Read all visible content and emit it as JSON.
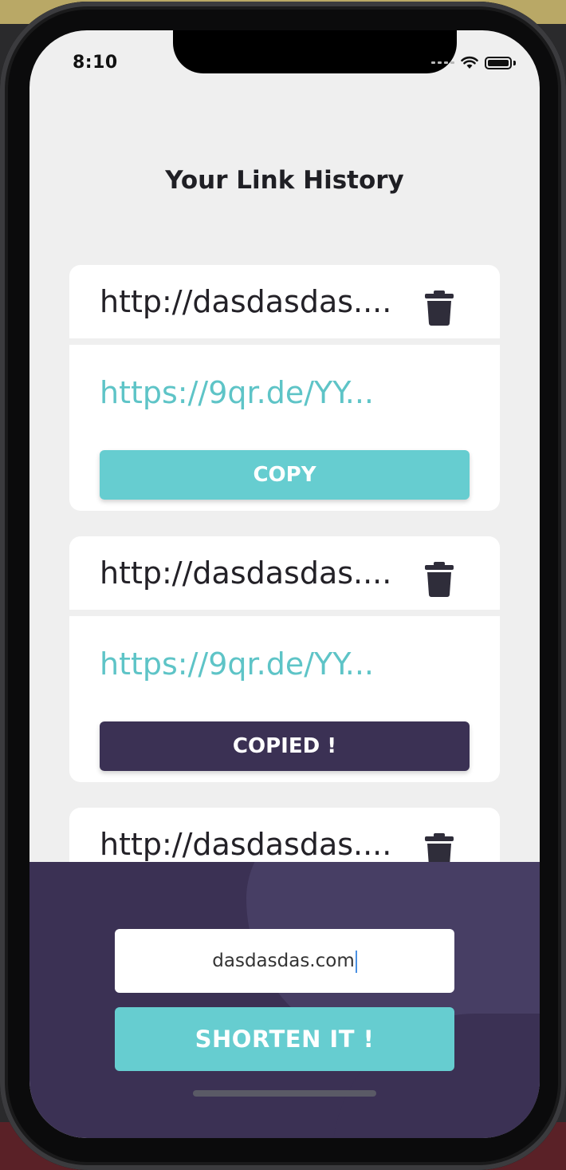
{
  "status_bar": {
    "time": "8:10"
  },
  "page": {
    "title": "Your Link History"
  },
  "links": [
    {
      "original": "http://dasdasdas....",
      "short": "https://9qr.de/YY...",
      "button": "COPY",
      "state": "default"
    },
    {
      "original": "http://dasdasdas....",
      "short": "https://9qr.de/YY...",
      "button": "COPIED !",
      "state": "copied"
    },
    {
      "original": "http://dasdasdas....",
      "short": "",
      "button": "",
      "state": "default"
    }
  ],
  "form": {
    "input_value": "dasdasdas.com",
    "submit_label": "SHORTEN IT !"
  },
  "icons": {
    "delete": "trash-icon",
    "wifi": "wifi-icon",
    "battery": "battery-icon",
    "signal": "signal-icon"
  },
  "colors": {
    "accent": "#66cdd0",
    "dark": "#3b3154",
    "link_text": "#5ec4c7",
    "background": "#efefef"
  }
}
